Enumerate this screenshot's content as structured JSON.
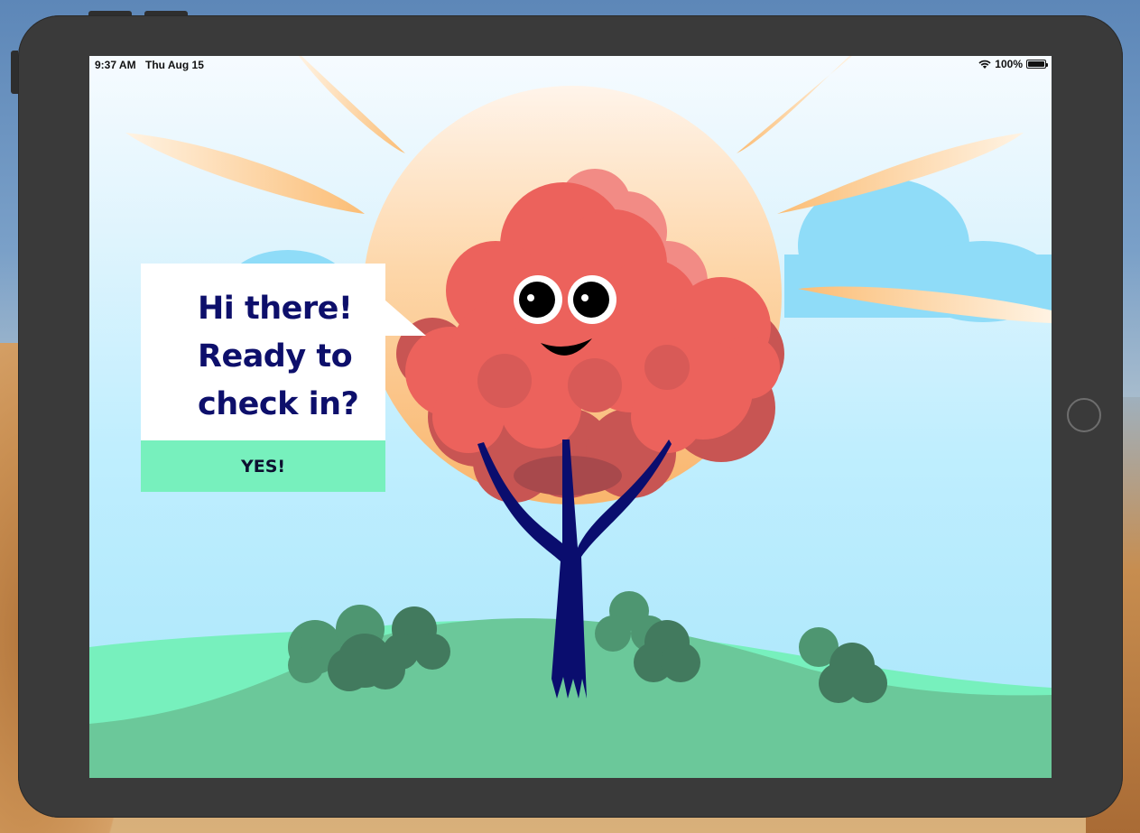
{
  "status_bar": {
    "time": "9:37 AM",
    "date": "Thu Aug 15",
    "battery_text": "100%",
    "battery_level": 1.0,
    "wifi_icon": "wifi-icon",
    "battery_icon": "battery-icon"
  },
  "speech_bubble": {
    "lines": [
      "Hi there!",
      "Ready to",
      "check in?"
    ],
    "button_label": "YES!"
  },
  "colors": {
    "title_text": "#0d0f6b",
    "button_bg": "#77f0bd",
    "tree_foliage": "#ec625c",
    "tree_trunk": "#0a0d6e",
    "sun": "#fcc48a",
    "hill_back": "#77f0bd",
    "hill_front": "#6bc89a",
    "bushes": "#427a5e"
  }
}
